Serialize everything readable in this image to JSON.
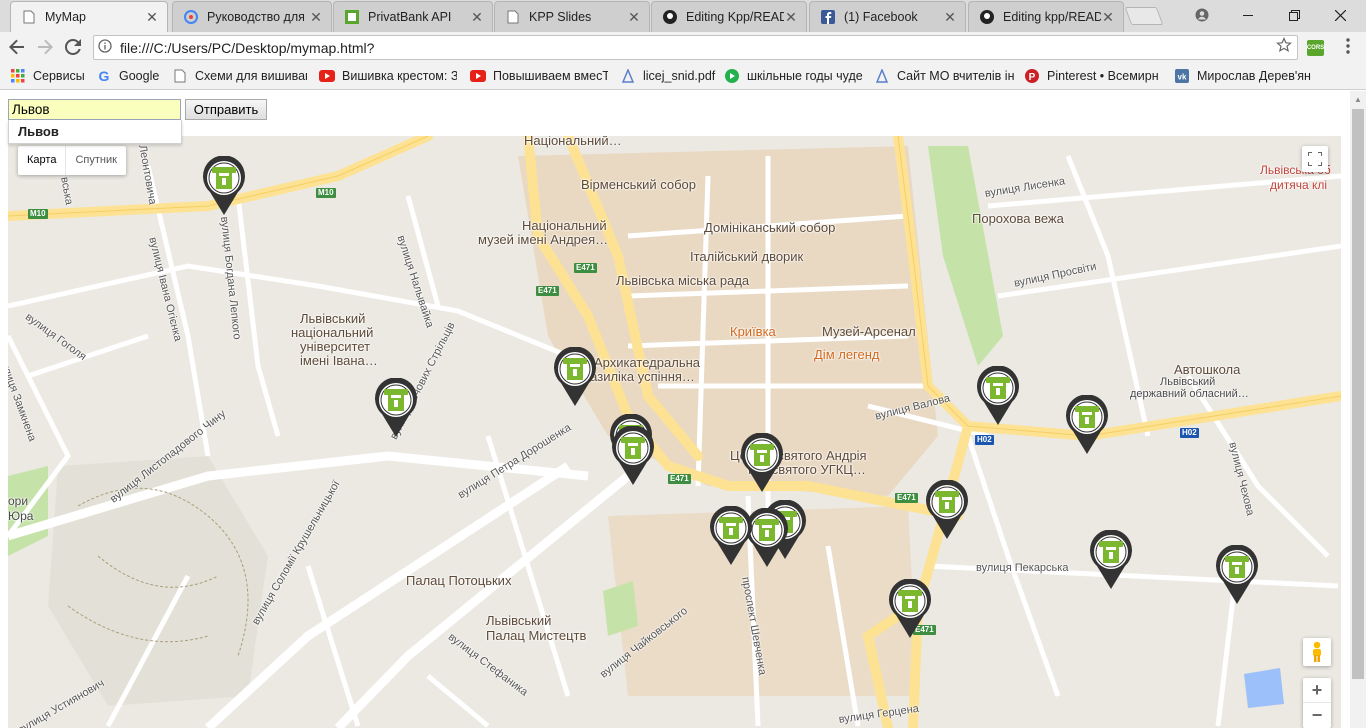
{
  "browser": {
    "tabs": [
      {
        "title": "MyMap",
        "icon": "document-icon",
        "active": true
      },
      {
        "title": "Руководство для р",
        "icon": "google-dev-icon",
        "active": false
      },
      {
        "title": "PrivatBank API",
        "icon": "privatbank-icon",
        "active": false
      },
      {
        "title": "KPP Slides",
        "icon": "document-icon",
        "active": false
      },
      {
        "title": "Editing Kpp/READ",
        "icon": "github-icon",
        "active": false
      },
      {
        "title": "(1) Facebook",
        "icon": "facebook-icon",
        "active": false
      },
      {
        "title": "Editing kpp/READ",
        "icon": "github-icon",
        "active": false
      }
    ],
    "close_glyph": "✕",
    "url": "file:///C:/Users/PC/Desktop/mymap.html?",
    "cors_label": "CORS",
    "bookmarks": [
      {
        "label": "Сервисы",
        "icon": "apps-grid-icon"
      },
      {
        "label": "Google",
        "icon": "google-icon"
      },
      {
        "label": "Схеми для вишиван",
        "icon": "document-icon"
      },
      {
        "label": "Вишивка крестом: З",
        "icon": "youtube-icon"
      },
      {
        "label": "Повышиваем вмесТ",
        "icon": "youtube-icon"
      },
      {
        "label": "licej_snid.pdf",
        "icon": "drive-icon"
      },
      {
        "label": "шкільные годы чуде",
        "icon": "play-icon"
      },
      {
        "label": "Сайт МО вчителів ін",
        "icon": "drive-icon"
      },
      {
        "label": "Pinterest • Всемирн",
        "icon": "pinterest-icon"
      },
      {
        "label": "Мирослав Дерев'ян",
        "icon": "vk-icon"
      }
    ]
  },
  "form": {
    "city_value": "Львов",
    "submit_label": "Отправить",
    "suggestion": "Львов"
  },
  "map": {
    "map_type_options": [
      "Карта",
      "Спутник"
    ],
    "zoom_in": "+",
    "zoom_out": "−",
    "poi_labels": [
      "Національний…",
      "Вірменський собор",
      "Національний",
      "музей імені Андрея…",
      "Домініканський собор",
      "Італійський дворик",
      "Львівська міська рада",
      "Порохова вежа",
      "Львівська об",
      "дитяча клі",
      "Криївка",
      "Музей-Арсенал",
      "Дім легенд",
      "Архикатедральна",
      "базиліка успіння…",
      "Львівський",
      "національний",
      "університет",
      "імені Івана…",
      "Автошкола",
      "Львівський",
      "державний обласний…",
      "Церква святого Андрія",
      "Пресвятого УГКЦ…",
      "Палац Потоцьких",
      "Львівський",
      "Палац Мистецтв",
      "ори",
      "Юра"
    ],
    "street_labels": [
      "вулиця Налывайка",
      "вулиця Богдана Лепкого",
      "вулиця Івана Огієнка",
      "Леонтовича",
      "вська",
      "вулиця Гоголя",
      "вулиця Листопадового Чину",
      "вулиця Січових Стрільців",
      "вулиця Петра Дорошенка",
      "вулиця Соломії Крушельницької",
      "вулиця Чайковського",
      "вулиця Стефаника",
      "вулиця Устиянович",
      "проспект Шевченка",
      "вулиця Валова",
      "вулиця Лисенка",
      "вулиця Просвіти",
      "вулиця Пекарська",
      "вулиця Чехова",
      "вулиця Герцена",
      "вулиця Замкнена"
    ],
    "road_shields": [
      "M10",
      "M10",
      "E471",
      "E471",
      "E471",
      "E471",
      "E471",
      "H02",
      "H02"
    ],
    "atm_markers": [
      {
        "name": "atm-1"
      },
      {
        "name": "atm-2"
      },
      {
        "name": "atm-3"
      },
      {
        "name": "atm-4"
      },
      {
        "name": "atm-5"
      },
      {
        "name": "atm-6"
      },
      {
        "name": "atm-7"
      },
      {
        "name": "atm-8"
      },
      {
        "name": "atm-9"
      },
      {
        "name": "atm-10"
      },
      {
        "name": "atm-11"
      },
      {
        "name": "atm-12"
      },
      {
        "name": "atm-13"
      },
      {
        "name": "atm-14"
      },
      {
        "name": "atm-15"
      }
    ],
    "colors": {
      "land": "#ece9e3",
      "roads_major": "#fde293",
      "roads_minor": "#ffffff",
      "old_town": "#e9d9c3",
      "parks": "#c5e2a8",
      "water": "#9cc0f9",
      "marker_ring": "#333333",
      "marker_fill": "#7cb82f"
    }
  }
}
